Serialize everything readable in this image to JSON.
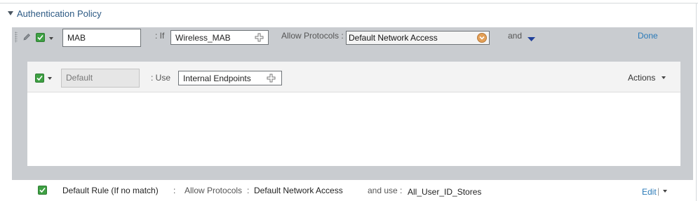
{
  "section": {
    "title": "Authentication Policy"
  },
  "rule": {
    "name_value": "MAB",
    "if_label": ": If",
    "condition": "Wireless_MAB",
    "allow_label": "Allow Protocols :",
    "protocol_selected": "Default Network Access",
    "and_label": "and",
    "done_label": "Done"
  },
  "inner_rule": {
    "name_value": "Default",
    "use_label": ": Use",
    "identity_source": "Internal Endpoints",
    "actions_label": "Actions"
  },
  "default_rule": {
    "name": "Default Rule (If no match)",
    "sep": ":",
    "allow_label": "Allow Protocols",
    "allow_sep": ":",
    "protocol": "Default Network Access",
    "use_label": "and use :",
    "identity_store": "All_User_ID_Stores",
    "edit_label": "Edit",
    "edit_sep": "|"
  }
}
